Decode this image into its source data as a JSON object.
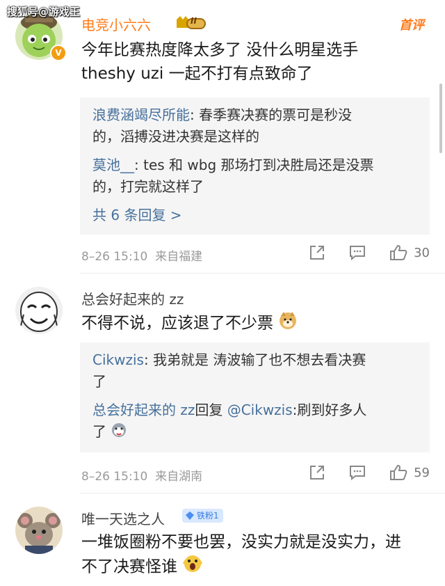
{
  "watermark": "搜狐号@游戏王",
  "comments": [
    {
      "name": "电竞小六六",
      "level_badge": "II",
      "top_label": "首评",
      "text_line1": "今年比赛热度降太多了 没什么明星选手",
      "text_line2": "theshy uzi 一起不打有点致命了",
      "replies": [
        {
          "name": "浪费涵竭尽所能",
          "text_a": "春季赛决赛的票可是秒没",
          "text_b": "的，滔搏没进决赛是这样的"
        },
        {
          "name": "莫池__",
          "text_a": "tes 和 wbg 那场打到决胜局还是没票",
          "text_b": "的，打完就这样了"
        }
      ],
      "more_replies": "共 6 条回复 >",
      "time": "8–26 15:10",
      "location": "来自福建",
      "likes": "30"
    },
    {
      "name": "总会好起来的 zz",
      "text": "不得不说，应该退了不少票",
      "replies": [
        {
          "name": "Cikwzis",
          "text_a": "我弟就是 涛波输了也不想去看决赛",
          "text_b": "了"
        },
        {
          "name": "总会好起来的 zz",
          "reply_word": "回复",
          "mention": "@Cikwzis",
          "text_a": "刷到好多人",
          "text_b": "了"
        }
      ],
      "time": "8–26 15:10",
      "location": "来自湖南",
      "likes": "59"
    },
    {
      "name": "唯一天选之人",
      "fan_badge": "铁粉1",
      "text_line1": "一堆饭圈粉不要也罢，没实力就是没实力，进",
      "text_line2": "不了决赛怪谁"
    }
  ],
  "icons": {
    "share": "share-icon",
    "comment": "comment-icon",
    "like": "thumbs-up-icon",
    "crown": "crown-icon",
    "fan": "diamond-icon"
  },
  "colors": {
    "name_orange": "#ff7b1a",
    "reply_name": "#46709c",
    "reply_bg": "#f5f5f5",
    "meta_gray": "#9a9a9a"
  }
}
